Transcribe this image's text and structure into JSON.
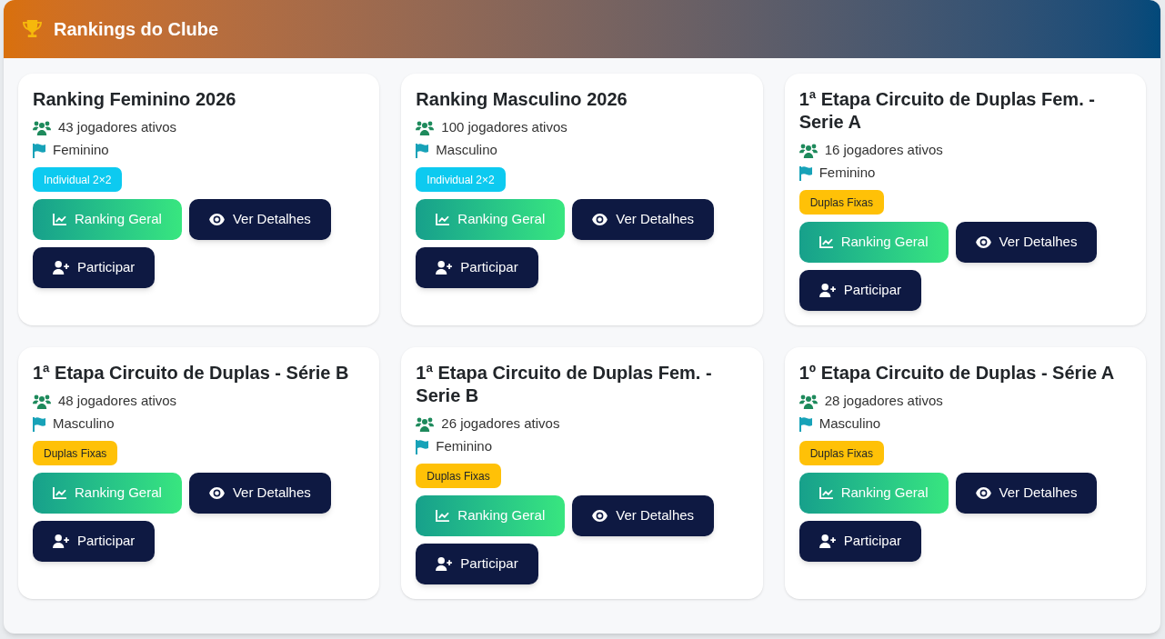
{
  "header": {
    "title": "Rankings do Clube"
  },
  "rankings": [
    {
      "title": "Ranking Feminino 2026",
      "players": "43 jogadores ativos",
      "category": "Feminino",
      "badge": {
        "kind": "individual",
        "label": "Individual 2×2"
      },
      "buttons": [
        {
          "kind": "ranking",
          "label": "Ranking Geral"
        },
        {
          "kind": "details",
          "label": "Ver Detalhes"
        },
        {
          "kind": "join",
          "label": "Participar"
        }
      ]
    },
    {
      "title": "Ranking Masculino 2026",
      "players": "100 jogadores ativos",
      "category": "Masculino",
      "badge": {
        "kind": "individual",
        "label": "Individual 2×2"
      },
      "buttons": [
        {
          "kind": "ranking",
          "label": "Ranking Geral"
        },
        {
          "kind": "details",
          "label": "Ver Detalhes"
        },
        {
          "kind": "join",
          "label": "Participar"
        }
      ]
    },
    {
      "title": "1ª Etapa Circuito de Duplas Fem. - Serie A",
      "players": "16 jogadores ativos",
      "category": "Feminino",
      "badge": {
        "kind": "doubles",
        "label": "Duplas Fixas"
      },
      "buttons": [
        {
          "kind": "ranking",
          "label": "Ranking Geral"
        },
        {
          "kind": "details",
          "label": "Ver Detalhes"
        },
        {
          "kind": "join",
          "label": "Participar"
        }
      ]
    },
    {
      "title": "1ª Etapa Circuito de Duplas - Série B",
      "players": "48 jogadores ativos",
      "category": "Masculino",
      "badge": {
        "kind": "doubles",
        "label": "Duplas Fixas"
      },
      "buttons": [
        {
          "kind": "ranking",
          "label": "Ranking Geral"
        },
        {
          "kind": "details",
          "label": "Ver Detalhes"
        },
        {
          "kind": "join",
          "label": "Participar"
        }
      ]
    },
    {
      "title": "1ª Etapa Circuito de Duplas Fem. - Serie B",
      "players": "26 jogadores ativos",
      "category": "Feminino",
      "badge": {
        "kind": "doubles",
        "label": "Duplas Fixas"
      },
      "buttons": [
        {
          "kind": "ranking",
          "label": "Ranking Geral"
        },
        {
          "kind": "details",
          "label": "Ver Detalhes"
        },
        {
          "kind": "join",
          "label": "Participar"
        }
      ]
    },
    {
      "title": "1º Etapa Circuito de Duplas - Série A",
      "players": "28 jogadores ativos",
      "category": "Masculino",
      "badge": {
        "kind": "doubles",
        "label": "Duplas Fixas"
      },
      "buttons": [
        {
          "kind": "ranking",
          "label": "Ranking Geral"
        },
        {
          "kind": "details",
          "label": "Ver Detalhes"
        },
        {
          "kind": "join",
          "label": "Participar"
        }
      ]
    }
  ]
}
